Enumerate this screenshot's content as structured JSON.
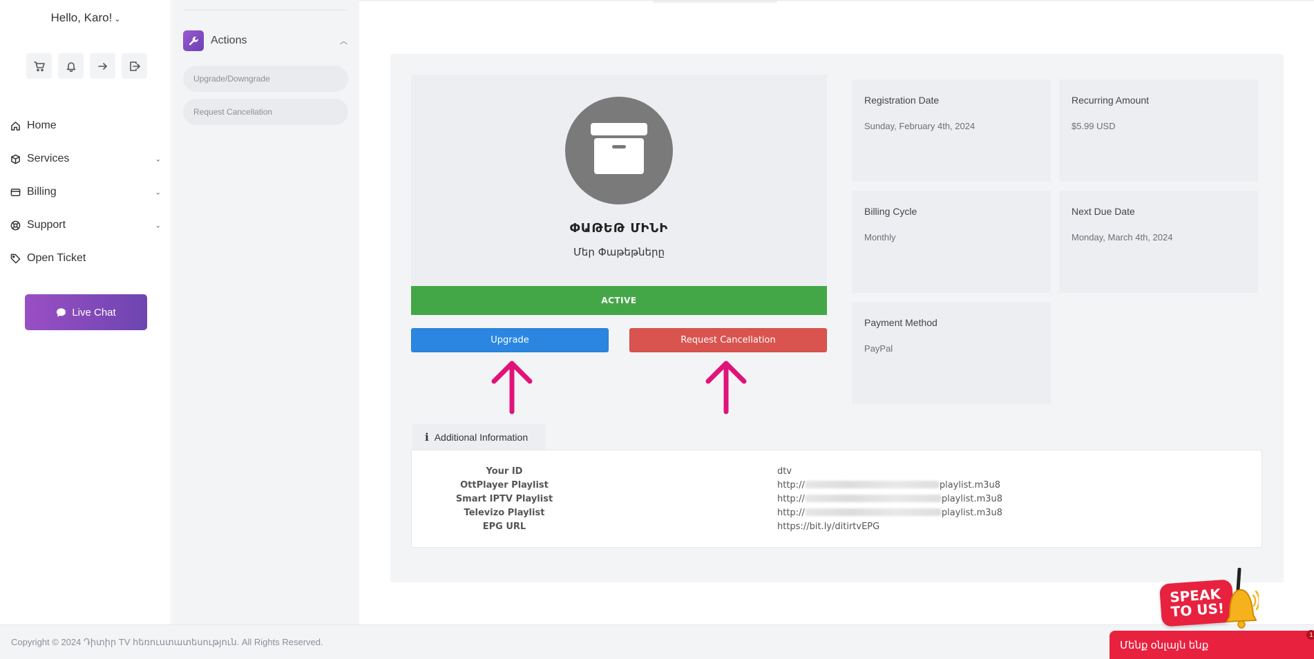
{
  "sidebar": {
    "greeting": "Hello, Karo!",
    "icons": [
      "cart-icon",
      "bell-icon",
      "arrow-right-icon",
      "logout-icon"
    ],
    "nav": [
      {
        "label": "Home",
        "icon": "home-icon"
      },
      {
        "label": "Services",
        "icon": "box-icon"
      },
      {
        "label": "Billing",
        "icon": "credit-card-icon"
      },
      {
        "label": "Support",
        "icon": "lifebuoy-icon"
      },
      {
        "label": "Open Ticket",
        "icon": "tag-icon"
      }
    ],
    "live_chat": "Live Chat"
  },
  "actions": {
    "title": "Actions",
    "items": [
      "Upgrade/Downgrade",
      "Request Cancellation"
    ]
  },
  "product": {
    "name": "ՓԱԹԵԹ ՄԻՆԻ",
    "group": "Մեր Փաթեթները",
    "status": "ACTIVE",
    "upgrade_label": "Upgrade",
    "cancel_label": "Request Cancellation"
  },
  "details": [
    {
      "label": "Registration Date",
      "value": "Sunday, February 4th, 2024"
    },
    {
      "label": "Recurring Amount",
      "value": "$5.99 USD"
    },
    {
      "label": "Billing Cycle",
      "value": "Monthly"
    },
    {
      "label": "Next Due Date",
      "value": "Monday, March 4th, 2024"
    },
    {
      "label": "Payment Method",
      "value": "PayPal"
    }
  ],
  "additional": {
    "tab_label": "Additional Information",
    "rows": [
      {
        "key": "Your ID",
        "value": "dtv"
      },
      {
        "key": "OttPlayer Playlist",
        "prefix": "http://",
        "suffix": "playlist.m3u8"
      },
      {
        "key": "Smart IPTV Playlist",
        "prefix": "http://",
        "suffix": "playlist.m3u8"
      },
      {
        "key": "Televizo Playlist",
        "prefix": "http://",
        "suffix": "playlist.m3u8"
      },
      {
        "key": "EPG URL",
        "value": "https://bit.ly/ditirtvEPG"
      }
    ]
  },
  "footer": {
    "copyright": "Copyright © 2024 Դիտիր TV հեռուստատեսություն. All Rights Reserved.",
    "chat_bar": "Մենք օնլայն ենք",
    "chat_badge": "1",
    "speak_line1": "SPEAK",
    "speak_line2": "TO US!"
  },
  "colors": {
    "active_green": "#44a747",
    "upgrade_blue": "#2a86e0",
    "cancel_red": "#d9534f",
    "arrow_pink": "#e0137a",
    "chat_red": "#e8213f",
    "brand_purple": "#7a48b8"
  }
}
